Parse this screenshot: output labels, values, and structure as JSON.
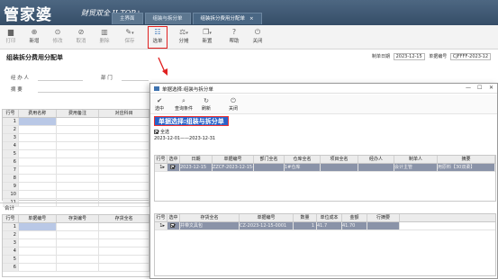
{
  "app": {
    "logo": "管家婆",
    "logo_sub": "财贸双全 II TOP+",
    "tabs": [
      {
        "label": "主界面",
        "active": false
      },
      {
        "label": "组装与拆分单",
        "active": false
      },
      {
        "label": "组装拆分费用分配单",
        "active": true,
        "close": "×"
      }
    ]
  },
  "toolbar": {
    "items": [
      {
        "key": "print",
        "label": "打印",
        "icon": "printer-icon",
        "glyph": "▆",
        "disabled": true
      },
      {
        "key": "new",
        "label": "新增",
        "icon": "plus-circle-icon",
        "glyph": "⊕"
      },
      {
        "key": "edit",
        "label": "修改",
        "icon": "edit-icon",
        "glyph": "⊙",
        "disabled": true
      },
      {
        "key": "cancel",
        "label": "取消",
        "icon": "cancel-icon",
        "glyph": "⊘",
        "disabled": true
      },
      {
        "key": "delete",
        "label": "删除",
        "icon": "trash-icon",
        "glyph": "▥",
        "disabled": true
      },
      {
        "key": "save",
        "label": "保存",
        "icon": "pencil-icon",
        "glyph": "✎",
        "disabled": true,
        "caret": "▾"
      },
      {
        "key": "select",
        "label": "选单",
        "icon": "list-select-icon",
        "glyph": "☷",
        "highlight": true
      },
      {
        "key": "split",
        "label": "分摊",
        "icon": "split-icon",
        "glyph": "⚖",
        "caret": "▾"
      },
      {
        "key": "template",
        "label": "新置",
        "icon": "copy-icon",
        "glyph": "❐",
        "caret": "▾"
      },
      {
        "key": "help",
        "label": "帮助",
        "icon": "help-icon",
        "glyph": "?"
      },
      {
        "key": "close",
        "label": "关闭",
        "icon": "power-icon",
        "glyph": "⏻"
      }
    ]
  },
  "form": {
    "title": "组装拆分费用分配单",
    "date_label": "制单日期",
    "date_value": "2023-12-15",
    "no_label": "单据编号",
    "no_value": "CJFFFF-2023-12",
    "handler_label": "经 办 人",
    "dept_label": "部    门",
    "summary_label": "摘    要",
    "sum_label": "合计"
  },
  "grid1": {
    "headers": [
      "行号",
      "费用名称",
      "费用备注",
      "对应科目"
    ],
    "rows": [
      "1",
      "2",
      "3",
      "4",
      "5",
      "6",
      "7",
      "8",
      "9",
      "10",
      "11"
    ]
  },
  "grid2": {
    "headers": [
      "行号",
      "单据编号",
      "存货编号",
      "存货全名"
    ],
    "rows": [
      "1",
      "2",
      "3",
      "4",
      "5",
      "6"
    ]
  },
  "dialog": {
    "title": "单据选择:组装与拆分单",
    "buttons": [
      {
        "label": "选中",
        "icon": "check-circle-icon",
        "glyph": "✔"
      },
      {
        "label": "查询条件",
        "icon": "search-icon",
        "glyph": "⌕"
      },
      {
        "label": "刷新",
        "icon": "refresh-icon",
        "glyph": "↻"
      },
      {
        "label": "关闭",
        "icon": "power-icon",
        "glyph": "⏻"
      }
    ],
    "banner": "单据选择:组装与拆分单",
    "select_all": "全选",
    "date_range": "2023-12-01——2023-12-31",
    "top_grid": {
      "headers": [
        "行号",
        "选中",
        "日期",
        "单据编号",
        "部门全名",
        "仓库全名",
        "项目全名",
        "经办人",
        "制单人",
        "摘要"
      ],
      "rows": [
        [
          "1",
          "",
          "2023-12-15",
          "ZZCF-2023-12-15-0001",
          "",
          "1#仓库",
          "",
          "",
          "会计主管",
          "用原料【30双柔】"
        ]
      ]
    },
    "bottom_grid": {
      "headers": [
        "行号",
        "选中",
        "存货全名",
        "单据编号",
        "数量",
        "单位成本",
        "金额",
        "行摘要"
      ],
      "rows": [
        [
          "1",
          "",
          "并带文具包",
          "CZ-2023-12-15-0001",
          "1",
          "41.7",
          "41.70",
          ""
        ]
      ]
    }
  }
}
